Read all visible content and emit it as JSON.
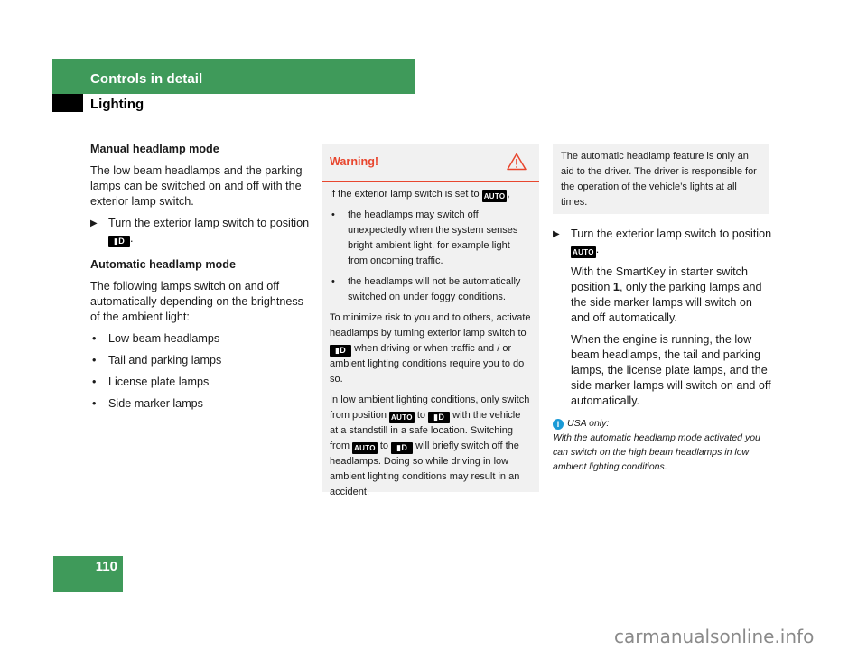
{
  "header": {
    "section_title": "Controls in detail",
    "subsection_title": "Lighting"
  },
  "left_column": {
    "manual_heading": "Manual headlamp mode",
    "manual_text": "The low beam headlamps and the parking lamps can be switched on and off with the exterior lamp switch.",
    "manual_step_text": "Turn the exterior lamp switch to position",
    "manual_step_symbol": "low-beam-symbol",
    "auto_heading": "Automatic headlamp mode",
    "auto_text": "The following lamps switch on and off automatically depending on the brightness of the ambient light:",
    "auto_lamps": [
      "Low beam headlamps",
      "Tail and parking lamps",
      "License plate lamps",
      "Side marker lamps"
    ]
  },
  "symbols": {
    "auto": "AUTO",
    "low_beam": "▮D"
  },
  "warning": {
    "title": "Warning!",
    "intro": "If the exterior lamp switch is set to",
    "bullets": [
      "the headlamps may switch off unexpectedly when the system senses bright ambient light, for example light from oncoming traffic.",
      "the headlamps will not be automatically switched on under foggy conditions."
    ],
    "para2_a": "To minimize risk to you and to others, activate headlamps by turning exterior lamp switch to",
    "para2_b": "when driving or when traffic and / or ambient lighting conditions require you to do so.",
    "para3_a": "In low ambient lighting conditions, only switch from position",
    "para3_b": "to",
    "para3_c": "with the vehicle at a standstill in a safe location. Switching from",
    "para3_d": "to",
    "para3_e": "will briefly switch off the headlamps. Doing so while driving in low ambient lighting conditions may result in an accident."
  },
  "note": {
    "text": "The automatic headlamp feature is only an aid to the driver. The driver is responsible for the operation of the vehicle’s lights at all times."
  },
  "right_column": {
    "step_text": "Turn the exterior lamp switch to position",
    "smartkey_a": "With the SmartKey in starter switch position",
    "smartkey_pos": "1",
    "smartkey_b": ", only the parking lamps and the side marker lamps will switch on and off automatically.",
    "engine_text": "When the engine is running, the low beam headlamps, the tail and parking lamps, the license plate lamps, and the side marker lamps will switch on and off automatically."
  },
  "info_note": {
    "label": "USA only:",
    "text": "With the automatic headlamp mode activated you can switch on the high beam headlamps in low ambient lighting conditions."
  },
  "footer": {
    "page_number": "110",
    "watermark": "carmanualsonline.info"
  },
  "colors": {
    "brand_green": "#3f9a5a",
    "warning_red": "#e8462e",
    "info_blue": "#1a9ad6",
    "box_gray": "#f1f1f1"
  }
}
